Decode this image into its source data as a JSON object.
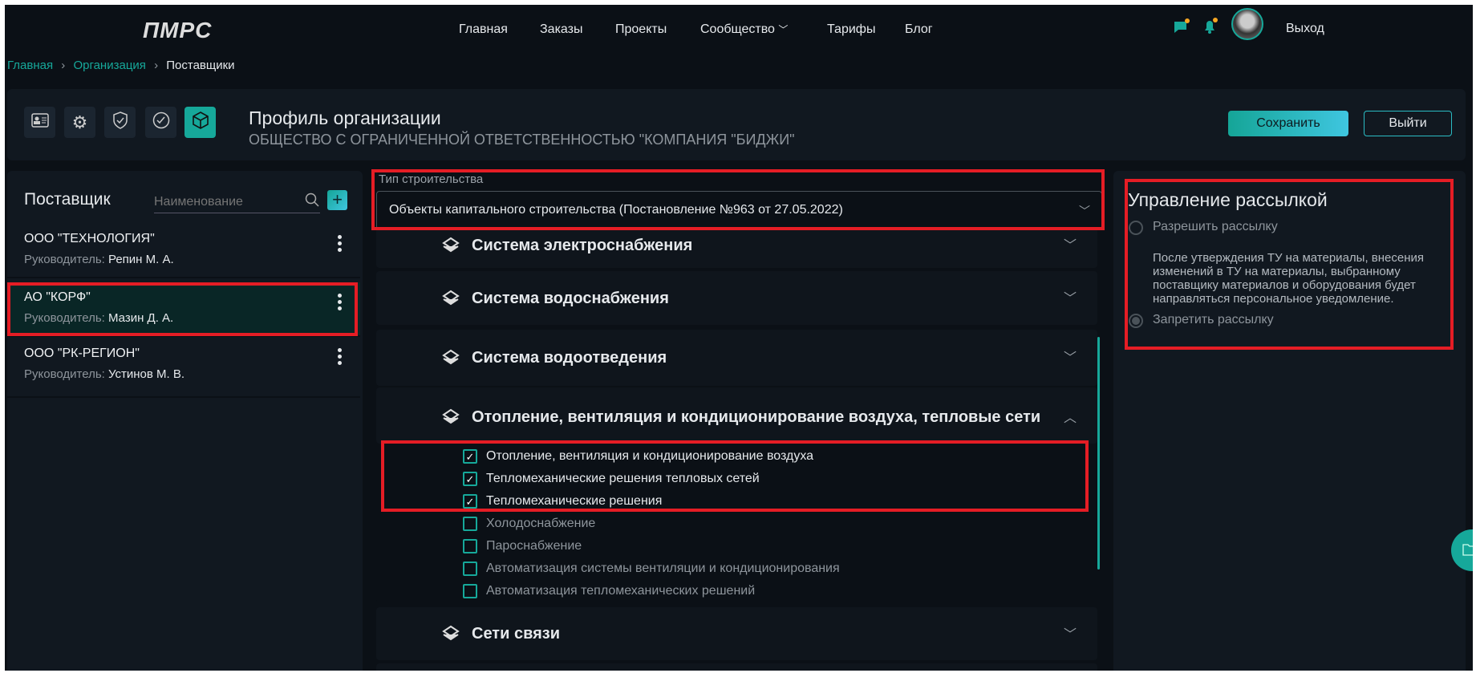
{
  "header": {
    "logo": "ПМРС",
    "nav": [
      "Главная",
      "Заказы",
      "Проекты",
      "Сообщество",
      "Тарифы",
      "Блог"
    ],
    "logout": "Выход",
    "icons": [
      "chat-icon",
      "bell-icon"
    ],
    "accent": "#16a89a",
    "notify_dot": "#f5a623"
  },
  "breadcrumb": [
    "Главная",
    "Организация",
    "Поставщики"
  ],
  "profile": {
    "title": "Профиль организации",
    "subtitle": "ОБЩЕСТВО С ОГРАНИЧЕННОЙ ОТВЕТСТВЕННОСТЬЮ \"КОМПАНИЯ \"БИДЖИ\"",
    "save": "Сохранить",
    "exit": "Выйти",
    "tabs": [
      "id-card-icon",
      "gear-icon",
      "shield-check-icon",
      "check-circle-icon",
      "box-icon"
    ]
  },
  "suppliers": {
    "title": "Поставщик",
    "search_placeholder": "Наименование",
    "manager_label": "Руководитель:",
    "items": [
      {
        "name": "ООО \"ТЕХНОЛОГИЯ\"",
        "manager": "Репин М. А."
      },
      {
        "name": "АО \"КОРФ\"",
        "manager": "Мазин Д. А.",
        "selected": true
      },
      {
        "name": "ООО \"РК-РЕГИОН\"",
        "manager": "Устинов М. В."
      }
    ]
  },
  "construction": {
    "label": "Тип строительства",
    "value": "Объекты капитального строительства (Постановление №963 от 27.05.2022)",
    "sections": [
      {
        "title": "Система электроснабжения",
        "expanded": false
      },
      {
        "title": "Система водоснабжения",
        "expanded": false
      },
      {
        "title": "Система водоотведения",
        "expanded": false
      },
      {
        "title": "Отопление, вентиляция и кондиционирование воздуха, тепловые сети",
        "expanded": true,
        "items": [
          {
            "label": "Отопление, вентиляция и кондиционирование воздуха",
            "checked": true
          },
          {
            "label": "Тепломеханические решения тепловых сетей",
            "checked": true
          },
          {
            "label": "Тепломеханические решения",
            "checked": true
          },
          {
            "label": "Холодоснабжение",
            "checked": false
          },
          {
            "label": "Пароснабжение",
            "checked": false
          },
          {
            "label": "Автоматизация системы вентиляции и кондиционирования",
            "checked": false
          },
          {
            "label": "Автоматизация тепломеханических решений",
            "checked": false
          }
        ]
      },
      {
        "title": "Сети связи",
        "expanded": false
      }
    ]
  },
  "mailing": {
    "title": "Управление рассылкой",
    "allow": "Разрешить рассылку",
    "description": "После утверждения ТУ на материалы, внесения изменений в ТУ на материалы, выбранному поставщику материалов и оборудования будет направляться персональное уведомление.",
    "deny": "Запретить рассылку",
    "selected": "deny"
  }
}
